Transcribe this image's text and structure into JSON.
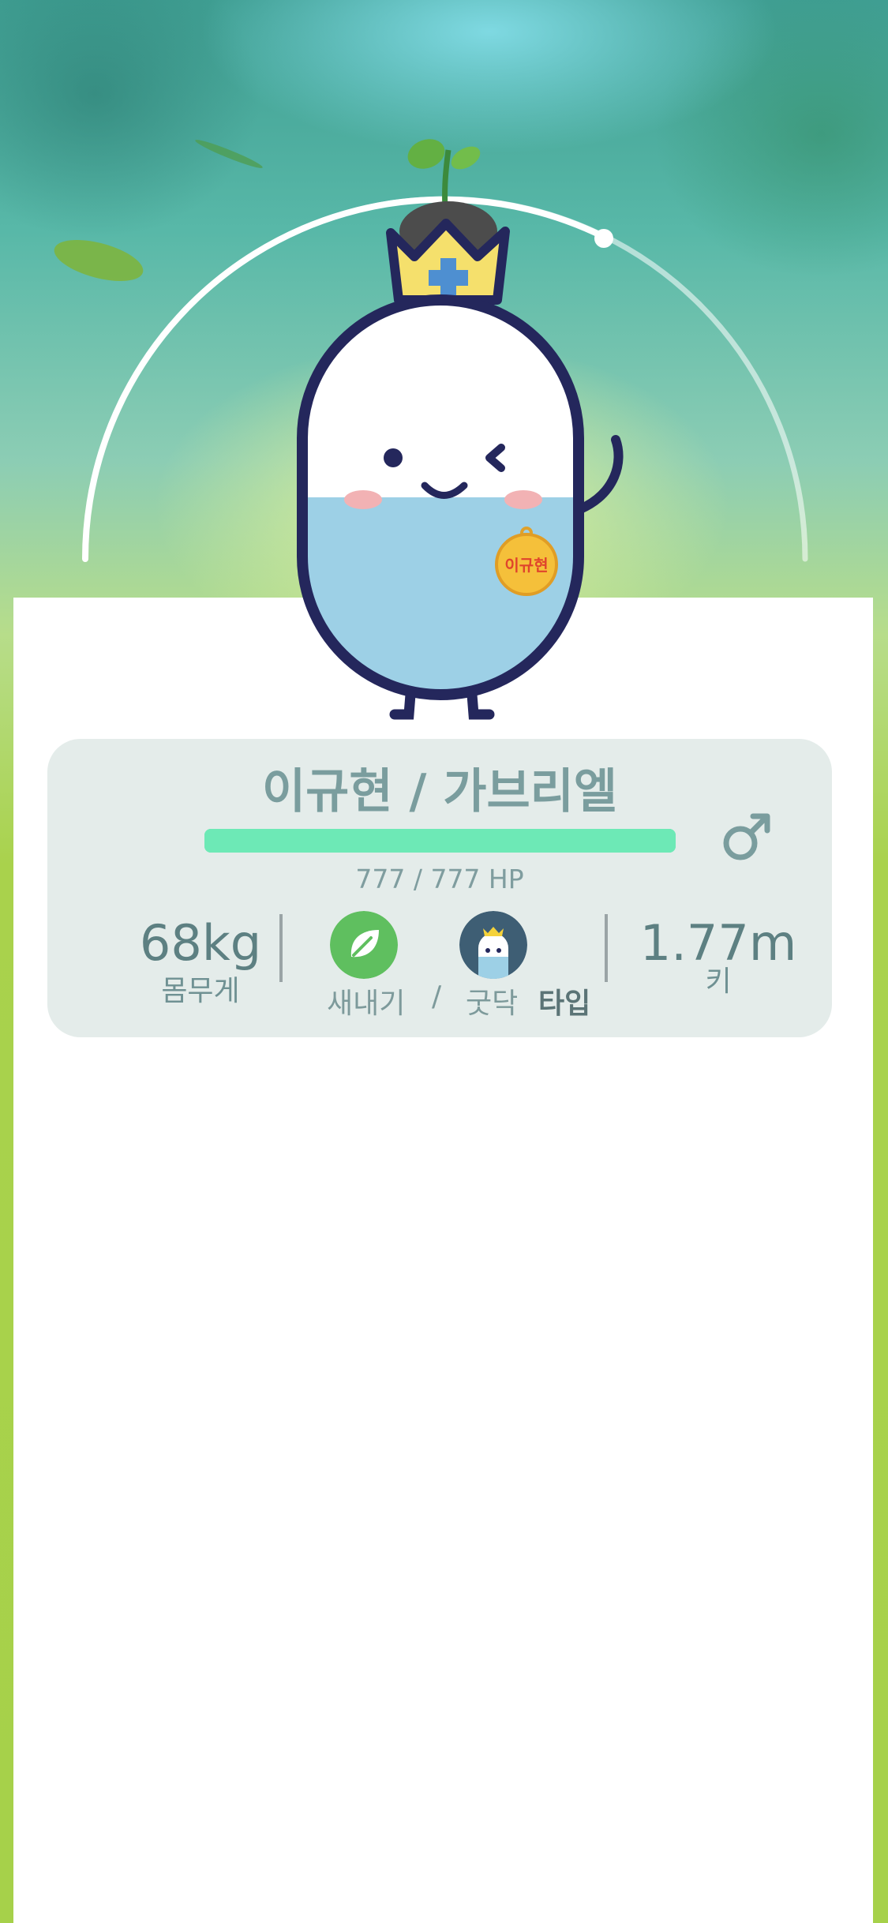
{
  "character": {
    "name": "이규현 / 가브리엘",
    "name_tag": "이규현",
    "gender_symbol": "♂",
    "hp_text": "777 / 777 HP",
    "hp_fraction": 1.0
  },
  "stats": {
    "weight_value": "68kg",
    "weight_label": "몸무게",
    "height_value": "1.77m",
    "height_label": "키"
  },
  "types": {
    "primary": "새내기",
    "separator": "/",
    "secondary": "굿닥",
    "suffix": "타입"
  },
  "icons": {
    "primary_type": "leaf-icon",
    "secondary_type": "goodoc-mascot-icon",
    "gender": "male-icon"
  },
  "colors": {
    "hp_bar": "#6de9b6",
    "card_bg": "#e4ecea",
    "text": "#7a9d9e",
    "leaf_badge": "#5fbf5f",
    "mascot_badge": "#3e5e74"
  }
}
